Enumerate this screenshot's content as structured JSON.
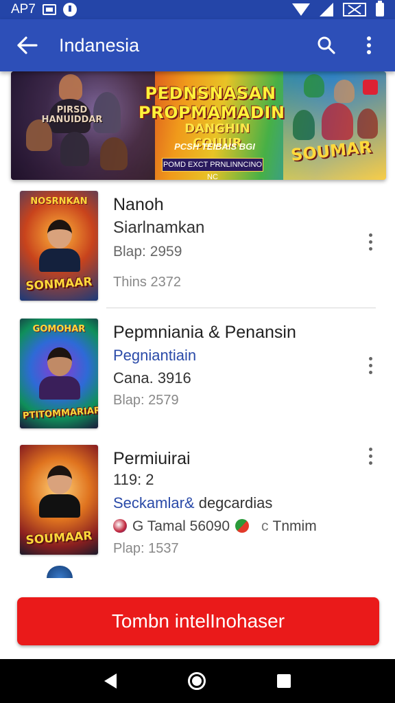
{
  "status_bar": {
    "left_text": "AP7",
    "icons": [
      "image-icon",
      "notification-icon",
      "wifi-icon",
      "signal-icon",
      "no-sim-icon",
      "battery-icon"
    ]
  },
  "app_bar": {
    "title": "Indanesia",
    "back_icon": "arrow-left-icon",
    "search_icon": "search-icon",
    "more_icon": "more-vert-icon",
    "color": "#2d4fb8"
  },
  "banner": {
    "title": "PEDNSNASAN PROPMAMADIN",
    "subtitle": "DANGHIN COUUR",
    "tagline": "PCSH TEIBAIS BGI",
    "strip_text": "POMD EXCT PRNLINNCINO NC",
    "logo_text": "SOUMAR",
    "left_poster_text": "PIRSD HANUIDDAR"
  },
  "items": [
    {
      "thumb_top": "NOSRNKAN",
      "thumb_bottom": "SONMAAR",
      "title": "Nanoh",
      "subtitle": "Siarlnamkan",
      "meta1": "Blap: 2959",
      "meta2": "Thins 2372"
    },
    {
      "thumb_top": "GOMOHAR",
      "thumb_bottom": "PTITOMMARIAR",
      "title": "Pepmniania & Penansin",
      "blue_line": "Pegniantiain",
      "meta1": "Cana. 3916",
      "meta2": "Blap: 2579"
    },
    {
      "thumb_top": "",
      "thumb_bottom": "SOUMAAR",
      "title": "Permiuirai",
      "line2": "119: 2",
      "blue_line": "Seckamlar&",
      "blue_line_rest": " degcardias",
      "icon_line_a": "G Tamal 56090",
      "icon_line_c": "c",
      "icon_line_b": "Tnmim",
      "meta1": "Plap: 1537"
    }
  ],
  "primary_button": {
    "label": "Tombn intelInohaser",
    "color": "#ea1a1a"
  },
  "nav_bar": {
    "icons": [
      "nav-back-icon",
      "nav-home-icon",
      "nav-recent-icon"
    ]
  }
}
